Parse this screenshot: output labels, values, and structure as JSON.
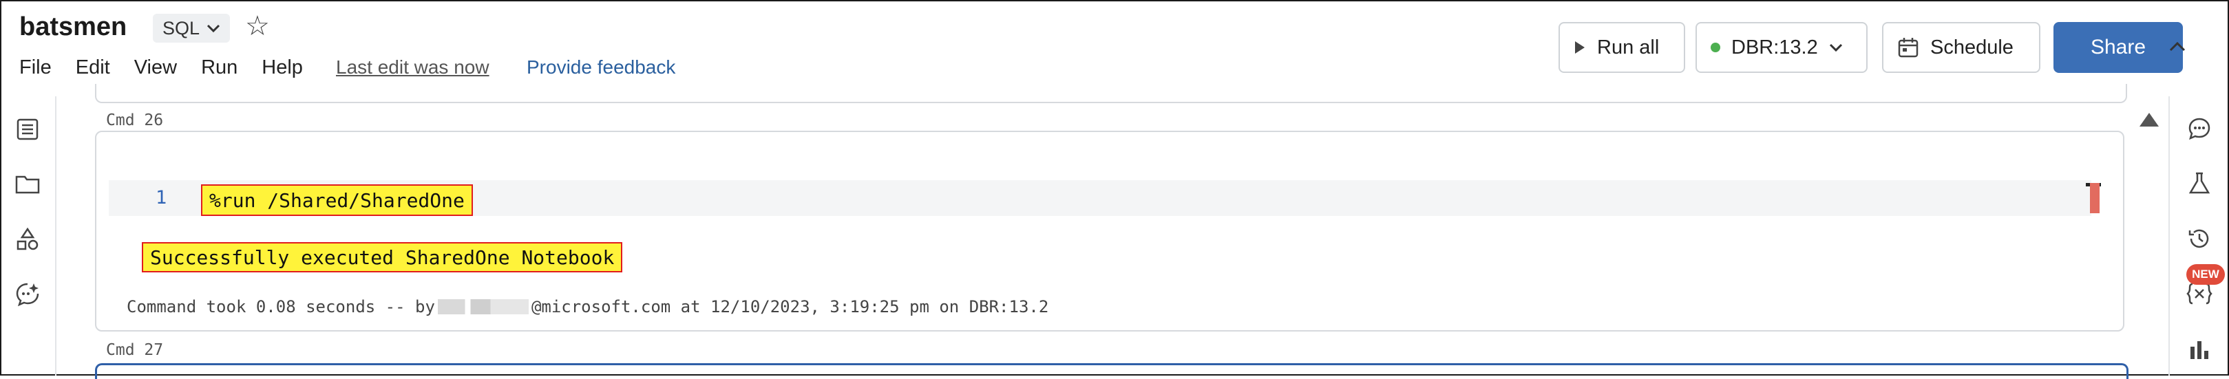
{
  "header": {
    "title": "batsmen",
    "language": "SQL",
    "menu": [
      "File",
      "Edit",
      "View",
      "Run",
      "Help"
    ],
    "last_edit": "Last edit was now",
    "feedback": "Provide feedback",
    "run_all": "Run all",
    "cluster": "DBR:13.2",
    "schedule": "Schedule",
    "share": "Share"
  },
  "notebook": {
    "cmd26_label": "Cmd 26",
    "cmd27_label": "Cmd 27",
    "line_number": "1",
    "code": "%run /Shared/SharedOne",
    "output": "Successfully executed SharedOne Notebook",
    "took_prefix": "Command took 0.08 seconds -- by",
    "took_suffix": "@microsoft.com at 12/10/2023, 3:19:25 pm on DBR:13.2"
  },
  "right_rail": {
    "new_badge": "NEW"
  },
  "colors": {
    "accent": "#3b6fb6",
    "highlight": "#fff33a",
    "highlight_border": "#e11d1d",
    "status_green": "#4caf50"
  },
  "icons": {
    "left_rail": [
      "table-of-contents-icon",
      "folder-icon",
      "shapes-icon",
      "assistant-icon"
    ],
    "right_rail": [
      "comments-icon",
      "experiment-icon",
      "history-icon",
      "variables-icon",
      "chart-icon"
    ]
  }
}
